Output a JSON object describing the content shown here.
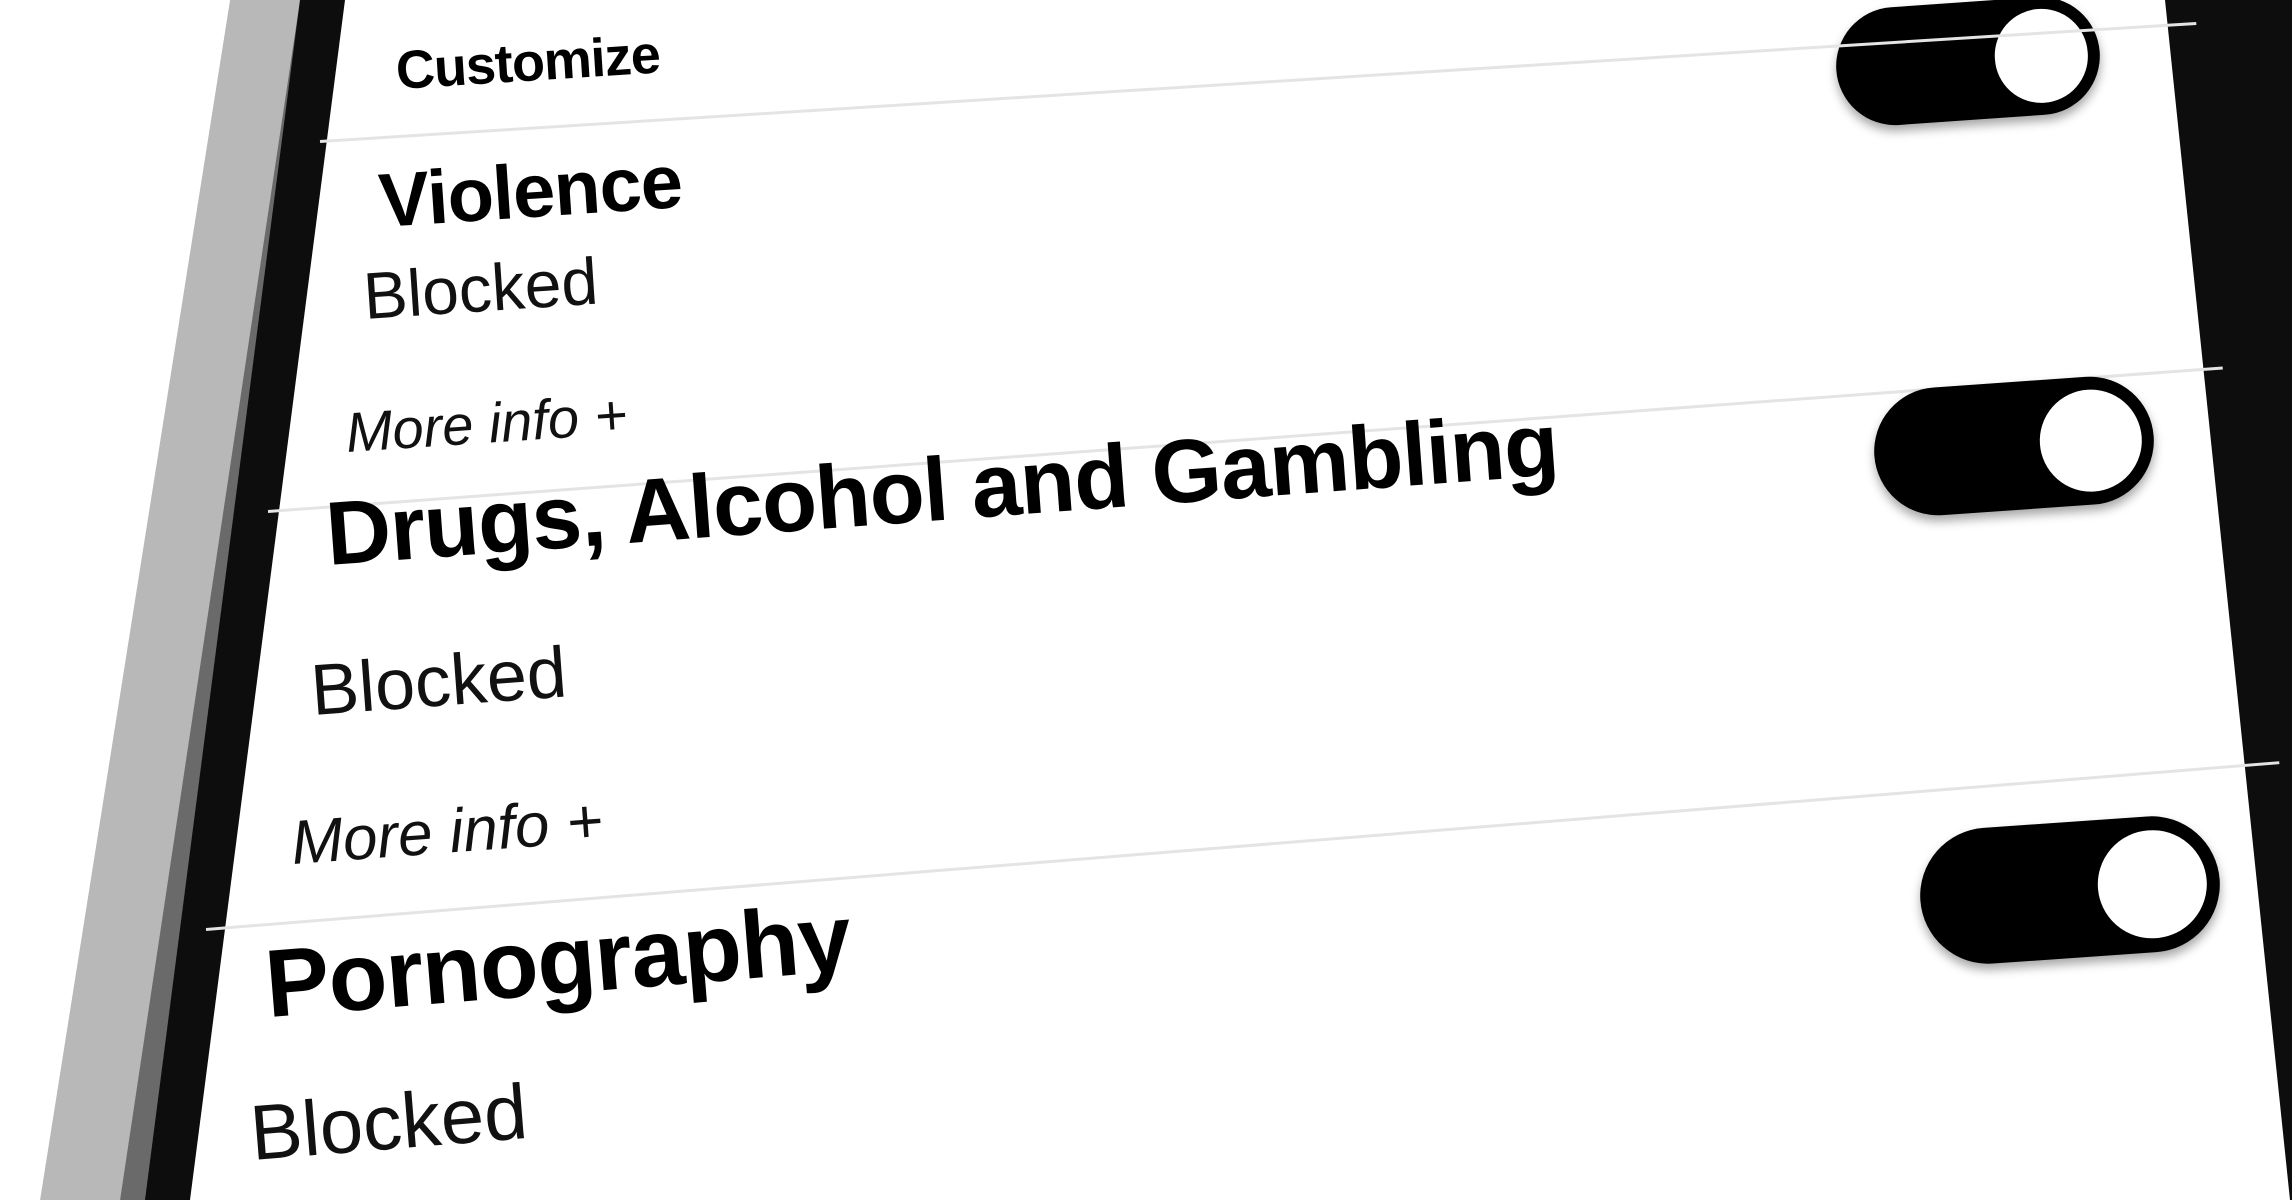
{
  "settings": {
    "header_label": "Customize",
    "header_toggle_on": true,
    "categories": [
      {
        "title": "Violence",
        "status": "Blocked",
        "more_info": "More info +",
        "toggle_on": true
      },
      {
        "title": "Drugs, Alcohol and Gambling",
        "status": "Blocked",
        "more_info": "More info +",
        "toggle_on": true
      },
      {
        "title": "Pornography",
        "status": "Blocked",
        "toggle_on": true
      }
    ]
  },
  "colors": {
    "background": "#ffffff",
    "text": "#000000",
    "toggle_track_on": "#000000",
    "toggle_knob": "#ffffff",
    "divider": "#e4e4e4",
    "device_frame": "#0d0d0d"
  }
}
